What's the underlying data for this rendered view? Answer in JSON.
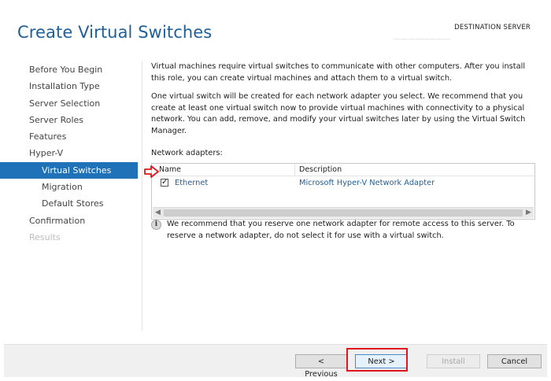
{
  "window": {
    "title": "Create Virtual Switches",
    "destination_label": "DESTINATION SERVER",
    "destination_value": "————————"
  },
  "nav": {
    "items": [
      {
        "label": "Before You Begin",
        "level": 0,
        "state": "normal"
      },
      {
        "label": "Installation Type",
        "level": 0,
        "state": "normal"
      },
      {
        "label": "Server Selection",
        "level": 0,
        "state": "normal"
      },
      {
        "label": "Server Roles",
        "level": 0,
        "state": "normal"
      },
      {
        "label": "Features",
        "level": 0,
        "state": "normal"
      },
      {
        "label": "Hyper-V",
        "level": 0,
        "state": "normal"
      },
      {
        "label": "Virtual Switches",
        "level": 1,
        "state": "active"
      },
      {
        "label": "Migration",
        "level": 1,
        "state": "normal"
      },
      {
        "label": "Default Stores",
        "level": 1,
        "state": "normal"
      },
      {
        "label": "Confirmation",
        "level": 0,
        "state": "normal"
      },
      {
        "label": "Results",
        "level": 0,
        "state": "disabled"
      }
    ]
  },
  "content": {
    "para1": "Virtual machines require virtual switches to communicate with other computers. After you install this role, you can create virtual machines and attach them to a virtual switch.",
    "para2": "One virtual switch will be created for each network adapter you select. We recommend that you create at least one virtual switch now to provide virtual machines with connectivity to a physical network. You can add, remove, and modify your virtual switches later by using the Virtual Switch Manager.",
    "network_adapters_label": "Network adapters:",
    "table": {
      "columns": [
        "Name",
        "Description"
      ],
      "rows": [
        {
          "checked": true,
          "name": "Ethernet",
          "description": "Microsoft Hyper-V Network Adapter"
        }
      ]
    },
    "info_text": "We recommend that you reserve one network adapter for remote access to this server. To reserve a network adapter, do not select it for use with a virtual switch."
  },
  "footer": {
    "previous_label": "< Previous",
    "next_label": "Next >",
    "install_label": "Install",
    "cancel_label": "Cancel"
  },
  "icons": {
    "info": "info-icon",
    "checkbox": "checkbox-checked",
    "scroll_left": "chevron-left-icon",
    "scroll_right": "chevron-right-icon",
    "annotation_arrow": "red-arrow-icon"
  },
  "colors": {
    "accent": "#1f72b8",
    "title": "#1f5f9a",
    "highlight": "#e0161c"
  }
}
